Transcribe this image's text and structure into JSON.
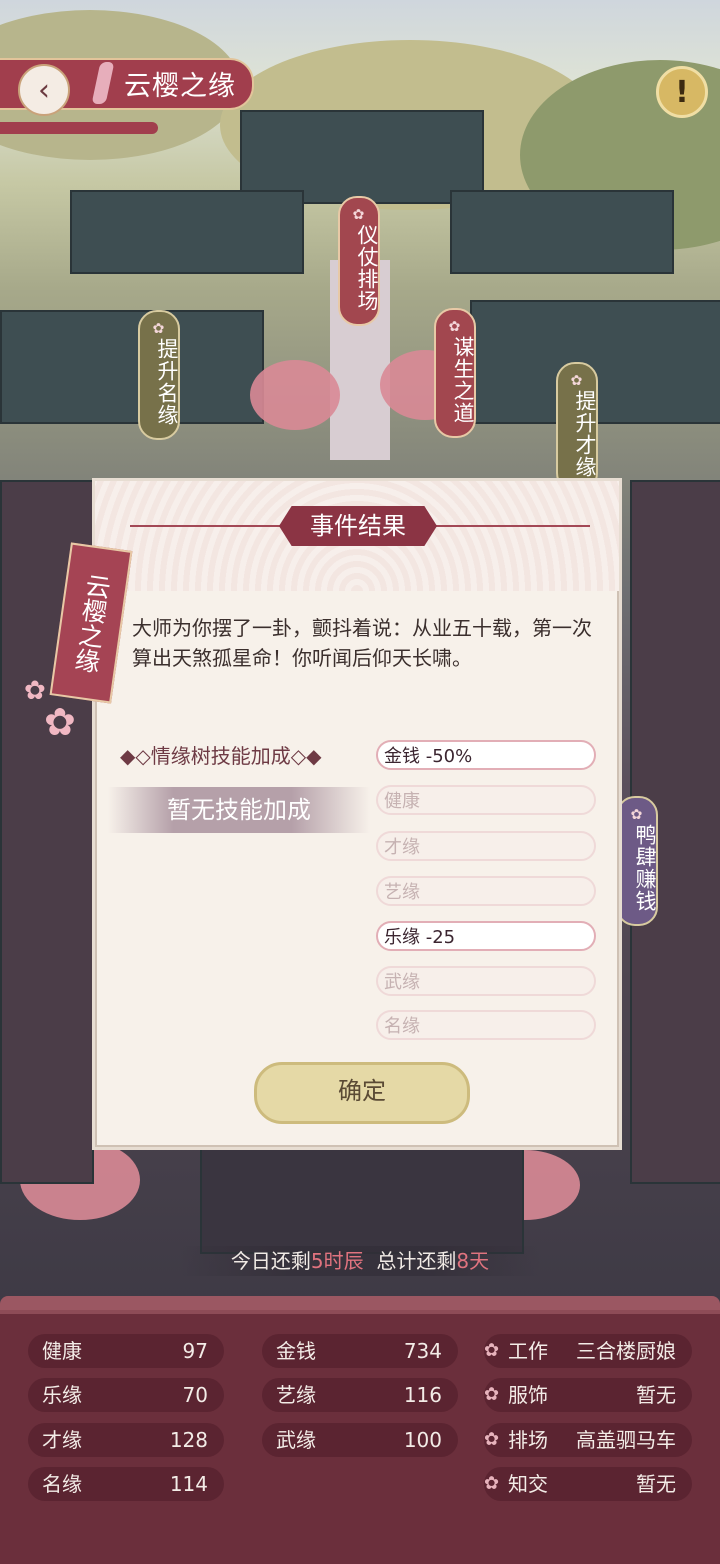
{
  "header": {
    "title": "云樱之缘"
  },
  "map_tags": [
    {
      "label": "仪仗排场",
      "style": "red"
    },
    {
      "label": "谋生之道",
      "style": "red"
    },
    {
      "label": "提升名缘",
      "style": "olive"
    },
    {
      "label": "提升才缘",
      "style": "olive"
    },
    {
      "label": "鸭肆赚钱",
      "style": "purple"
    }
  ],
  "dialog": {
    "title": "事件结果",
    "side_label": "云樱之缘",
    "story": "大师为你摆了一卦，颤抖着说：从业五十载，第一次算出天煞孤星命！你听闻后仰天长啸。",
    "bonus_label": "◆◇情缘树技能加成◇◆",
    "no_bonus": "暂无技能加成",
    "effects": [
      {
        "text": "金钱 -50%",
        "active": true
      },
      {
        "text": "健康",
        "active": false
      },
      {
        "text": "才缘",
        "active": false
      },
      {
        "text": "艺缘",
        "active": false
      },
      {
        "text": "乐缘 -25",
        "active": true
      },
      {
        "text": "武缘",
        "active": false
      },
      {
        "text": "名缘",
        "active": false
      }
    ],
    "confirm": "确定"
  },
  "time": {
    "prefix": "今日还剩",
    "hours": "5时辰",
    "mid": "总计还剩",
    "days": "8天"
  },
  "stats": {
    "col1": [
      {
        "label": "健康",
        "value": "97"
      },
      {
        "label": "乐缘",
        "value": "70"
      },
      {
        "label": "才缘",
        "value": "128"
      },
      {
        "label": "名缘",
        "value": "114"
      }
    ],
    "col2": [
      {
        "label": "金钱",
        "value": "734"
      },
      {
        "label": "艺缘",
        "value": "116"
      },
      {
        "label": "武缘",
        "value": "100"
      }
    ],
    "info": [
      {
        "label": "工作",
        "value": "三合楼厨娘"
      },
      {
        "label": "服饰",
        "value": "暂无"
      },
      {
        "label": "排场",
        "value": "高盖驷马车"
      },
      {
        "label": "知交",
        "value": "暂无"
      }
    ]
  }
}
